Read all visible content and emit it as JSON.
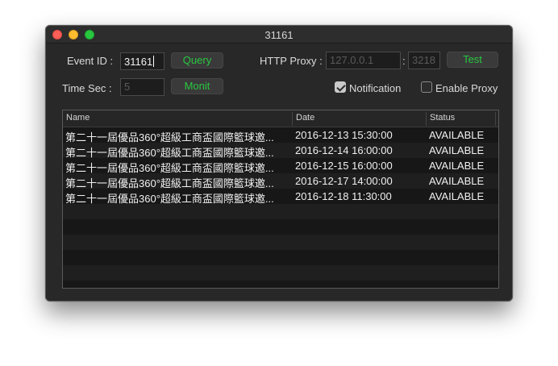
{
  "window": {
    "title": "31161"
  },
  "form": {
    "event_id_label": "Event ID :",
    "event_id_value": "31161",
    "query_label": "Query",
    "time_sec_label": "Time Sec :",
    "time_sec_value": "5",
    "monit_label": "Monit",
    "proxy_label": "HTTP Proxy :",
    "proxy_host": "127.0.0.1",
    "proxy_sep": ":",
    "proxy_port": "3218",
    "test_label": "Test",
    "notification_label": "Notification",
    "notification_checked": true,
    "enable_proxy_label": "Enable Proxy",
    "enable_proxy_checked": false
  },
  "table": {
    "headers": [
      "Name",
      "Date",
      "Status"
    ],
    "rows": [
      {
        "name": "第二十一屆優品360°超級工商盃國際籃球邀...",
        "date": "2016-12-13 15:30:00",
        "status": "AVAILABLE"
      },
      {
        "name": "第二十一屆優品360°超級工商盃國際籃球邀...",
        "date": "2016-12-14 16:00:00",
        "status": "AVAILABLE"
      },
      {
        "name": "第二十一屆優品360°超級工商盃國際籃球邀...",
        "date": "2016-12-15 16:00:00",
        "status": "AVAILABLE"
      },
      {
        "name": "第二十一屆優品360°超級工商盃國際籃球邀...",
        "date": "2016-12-17 14:00:00",
        "status": "AVAILABLE"
      },
      {
        "name": "第二十一屆優品360°超級工商盃國際籃球邀...",
        "date": "2016-12-18 11:30:00",
        "status": "AVAILABLE"
      }
    ]
  },
  "colors": {
    "accent_green": "#28c840",
    "window_bg": "#282828"
  }
}
